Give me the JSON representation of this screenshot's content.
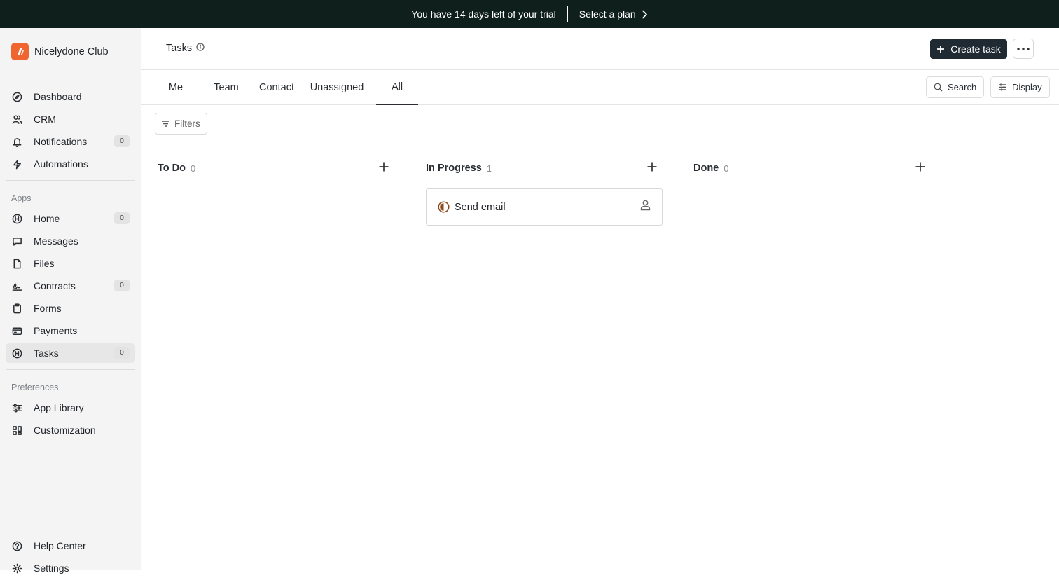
{
  "banner": {
    "message": "You have 14 days left of your trial",
    "cta": "Select a plan"
  },
  "brand": {
    "name": "Nicelydone Club",
    "accent": "#f0642f"
  },
  "sidebar": {
    "main_items": [
      {
        "label": "Dashboard",
        "icon": "compass-icon"
      },
      {
        "label": "CRM",
        "icon": "users-icon"
      },
      {
        "label": "Notifications",
        "icon": "bell-icon",
        "badge": "0"
      },
      {
        "label": "Automations",
        "icon": "lightning-icon"
      }
    ],
    "apps_section": "Apps",
    "app_items": [
      {
        "label": "Home",
        "icon": "home-app-icon",
        "badge": "0"
      },
      {
        "label": "Messages",
        "icon": "message-icon"
      },
      {
        "label": "Files",
        "icon": "file-icon"
      },
      {
        "label": "Contracts",
        "icon": "signature-icon",
        "badge": "0"
      },
      {
        "label": "Forms",
        "icon": "clipboard-icon"
      },
      {
        "label": "Payments",
        "icon": "credit-card-icon"
      },
      {
        "label": "Tasks",
        "icon": "tasks-app-icon",
        "badge": "0",
        "active": true
      }
    ],
    "preferences_section": "Preferences",
    "pref_items": [
      {
        "label": "App Library",
        "icon": "sliders-icon"
      },
      {
        "label": "Customization",
        "icon": "grid-icon"
      }
    ],
    "bottom_items": [
      {
        "label": "Help Center",
        "icon": "help-icon"
      },
      {
        "label": "Settings",
        "icon": "gear-icon"
      }
    ]
  },
  "header": {
    "title": "Tasks",
    "create_label": "Create task"
  },
  "tabs": [
    "Me",
    "Team",
    "Contact",
    "Unassigned",
    "All"
  ],
  "active_tab": "All",
  "toolbar": {
    "search_label": "Search",
    "display_label": "Display",
    "filters_label": "Filters"
  },
  "board": {
    "columns": [
      {
        "title": "To Do",
        "count": "0"
      },
      {
        "title": "In Progress",
        "count": "1"
      },
      {
        "title": "Done",
        "count": "0"
      }
    ],
    "cards": [
      {
        "title": "Send email",
        "column": "In Progress",
        "status_color": "#8a4a1c"
      }
    ]
  }
}
